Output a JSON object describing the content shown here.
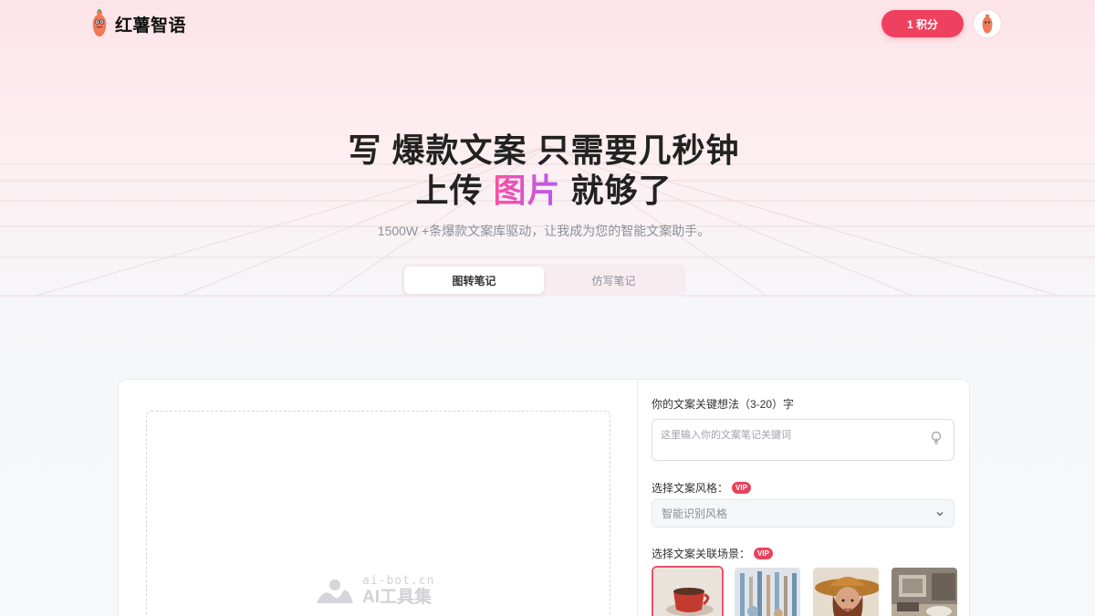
{
  "header": {
    "brand_name": "红薯智语",
    "credits_label": "1 积分"
  },
  "hero": {
    "line1": "写 爆款文案 只需要几秒钟",
    "line2_pre": "上传 ",
    "line2_accent": "图片",
    "line2_post": " 就够了",
    "subtitle": "1500W +条爆款文案库驱动，让我成为您的智能文案助手。"
  },
  "tabs": [
    {
      "label": "图转笔记",
      "active": true
    },
    {
      "label": "仿写笔记",
      "active": false
    }
  ],
  "form": {
    "keyword_label": "你的文案关键想法（3-20）字",
    "keyword_placeholder": "这里输入你的文案笔记关键词",
    "style_label": "选择文案风格：",
    "style_value": "智能识别风格",
    "scene_label": "选择文案关联场景：",
    "vip_badge": "VIP",
    "scenes": [
      {
        "name": "coffee-cup",
        "selected": true
      },
      {
        "name": "brushes",
        "selected": false
      },
      {
        "name": "woman-hat",
        "selected": false
      },
      {
        "name": "interior-room",
        "selected": false
      }
    ]
  },
  "watermark": {
    "domain": "ai-bot.cn",
    "name": "AI工具集"
  },
  "colors": {
    "accent": "#f0405f",
    "vip": "#e9415c",
    "gradient_start": "#ff4fa0",
    "gradient_end": "#b15cf2"
  }
}
